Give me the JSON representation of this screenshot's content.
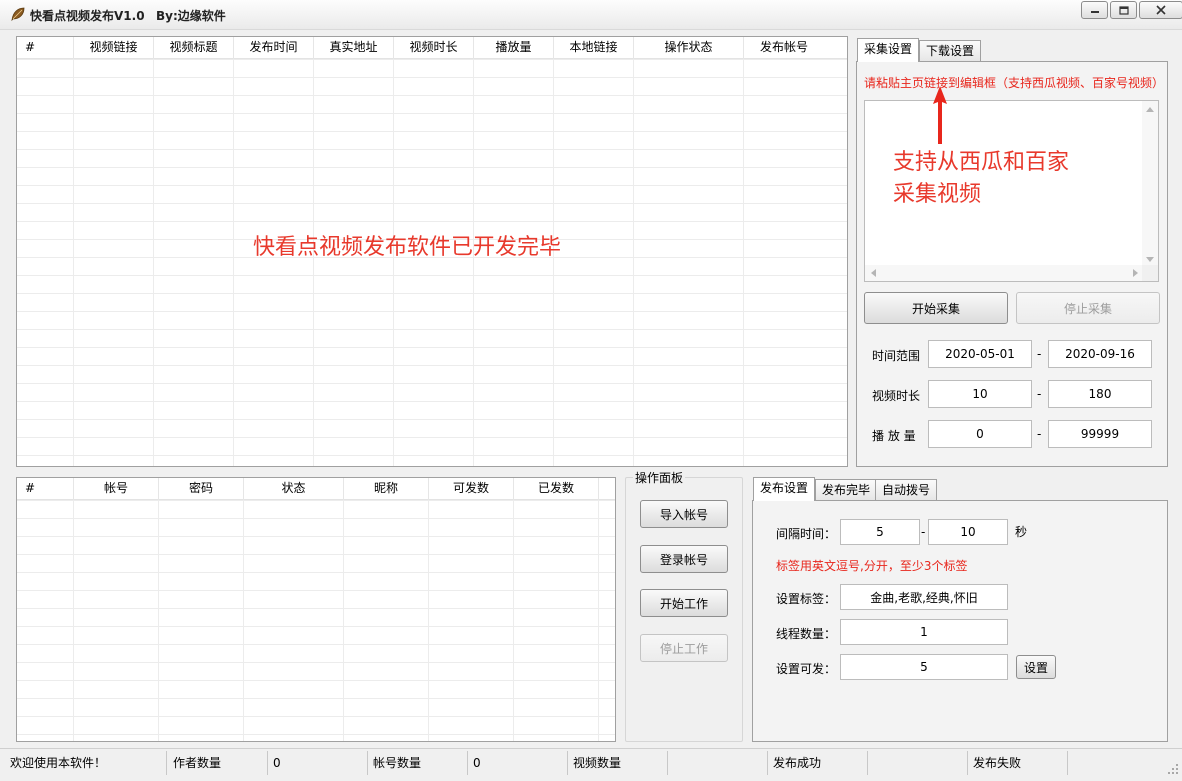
{
  "window": {
    "title": "快看点视频发布V1.0",
    "author": "By:边缘软件"
  },
  "video_table": {
    "columns": [
      "#",
      "视频链接",
      "视频标题",
      "发布时间",
      "真实地址",
      "视频时长",
      "播放量",
      "本地链接",
      "操作状态",
      "发布帐号"
    ],
    "overlay_message": "快看点视频发布软件已开发完毕"
  },
  "collect_panel": {
    "tabs": [
      "采集设置",
      "下载设置"
    ],
    "active_tab": "采集设置",
    "instruction": "请粘贴主页链接到编辑框（支持西瓜视频、百家号视频）",
    "annotation_line1": "支持从西瓜和百家",
    "annotation_line2": "采集视频",
    "start_button": "开始采集",
    "stop_button": "停止采集",
    "time_range_label": "时间范围",
    "time_from": "2020-05-01",
    "time_to": "2020-09-16",
    "duration_label": "视频时长",
    "duration_from": "10",
    "duration_to": "180",
    "plays_label": "播 放 量",
    "plays_from": "0",
    "plays_to": "99999",
    "dash": "-"
  },
  "account_table": {
    "columns": [
      "#",
      "帐号",
      "密码",
      "状态",
      "昵称",
      "可发数",
      "已发数"
    ]
  },
  "ops_panel": {
    "title": "操作面板",
    "import_button": "导入帐号",
    "login_button": "登录帐号",
    "start_button": "开始工作",
    "stop_button": "停止工作"
  },
  "publish_panel": {
    "tabs": [
      "发布设置",
      "发布完毕",
      "自动拨号"
    ],
    "active_tab": "发布设置",
    "interval_label": "间隔时间：",
    "interval_from": "5",
    "interval_to": "10",
    "interval_unit": "秒",
    "tag_note": "标签用英文逗号,分开，至少3个标签",
    "tags_label": "设置标签：",
    "tags_value": "金曲,老歌,经典,怀旧",
    "threads_label": "线程数量：",
    "threads_value": "1",
    "quota_label": "设置可发：",
    "quota_value": "5",
    "set_button": "设置",
    "dash": "-"
  },
  "statusbar": {
    "welcome": "欢迎使用本软件！",
    "author_count_label": "作者数量",
    "author_count": "0",
    "account_count_label": "帐号数量",
    "account_count": "0",
    "video_count_label": "视频数量",
    "video_count": "",
    "success_label": "发布成功",
    "success_value": "",
    "fail_label": "发布失败"
  },
  "colors": {
    "accent_red": "#e8392c",
    "window_bg": "#f0f0f0"
  }
}
